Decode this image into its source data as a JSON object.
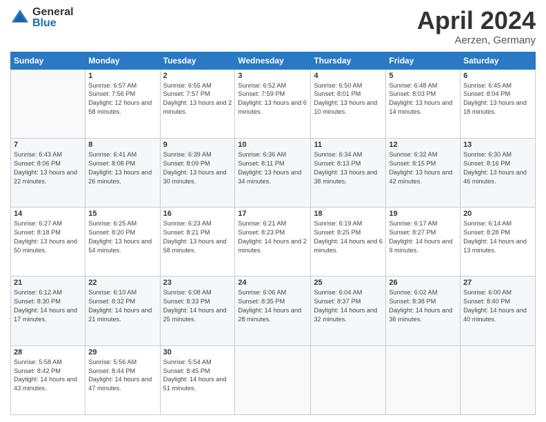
{
  "header": {
    "logo_general": "General",
    "logo_blue": "Blue",
    "month_title": "April 2024",
    "location": "Aerzen, Germany"
  },
  "weekdays": [
    "Sunday",
    "Monday",
    "Tuesday",
    "Wednesday",
    "Thursday",
    "Friday",
    "Saturday"
  ],
  "weeks": [
    [
      {
        "day": "",
        "sunrise": "",
        "sunset": "",
        "daylight": ""
      },
      {
        "day": "1",
        "sunrise": "Sunrise: 6:57 AM",
        "sunset": "Sunset: 7:56 PM",
        "daylight": "Daylight: 12 hours and 58 minutes."
      },
      {
        "day": "2",
        "sunrise": "Sunrise: 6:55 AM",
        "sunset": "Sunset: 7:57 PM",
        "daylight": "Daylight: 13 hours and 2 minutes."
      },
      {
        "day": "3",
        "sunrise": "Sunrise: 6:52 AM",
        "sunset": "Sunset: 7:59 PM",
        "daylight": "Daylight: 13 hours and 6 minutes."
      },
      {
        "day": "4",
        "sunrise": "Sunrise: 6:50 AM",
        "sunset": "Sunset: 8:01 PM",
        "daylight": "Daylight: 13 hours and 10 minutes."
      },
      {
        "day": "5",
        "sunrise": "Sunrise: 6:48 AM",
        "sunset": "Sunset: 8:03 PM",
        "daylight": "Daylight: 13 hours and 14 minutes."
      },
      {
        "day": "6",
        "sunrise": "Sunrise: 6:45 AM",
        "sunset": "Sunset: 8:04 PM",
        "daylight": "Daylight: 13 hours and 18 minutes."
      }
    ],
    [
      {
        "day": "7",
        "sunrise": "Sunrise: 6:43 AM",
        "sunset": "Sunset: 8:06 PM",
        "daylight": "Daylight: 13 hours and 22 minutes."
      },
      {
        "day": "8",
        "sunrise": "Sunrise: 6:41 AM",
        "sunset": "Sunset: 8:08 PM",
        "daylight": "Daylight: 13 hours and 26 minutes."
      },
      {
        "day": "9",
        "sunrise": "Sunrise: 6:39 AM",
        "sunset": "Sunset: 8:09 PM",
        "daylight": "Daylight: 13 hours and 30 minutes."
      },
      {
        "day": "10",
        "sunrise": "Sunrise: 6:36 AM",
        "sunset": "Sunset: 8:11 PM",
        "daylight": "Daylight: 13 hours and 34 minutes."
      },
      {
        "day": "11",
        "sunrise": "Sunrise: 6:34 AM",
        "sunset": "Sunset: 8:13 PM",
        "daylight": "Daylight: 13 hours and 38 minutes."
      },
      {
        "day": "12",
        "sunrise": "Sunrise: 6:32 AM",
        "sunset": "Sunset: 8:15 PM",
        "daylight": "Daylight: 13 hours and 42 minutes."
      },
      {
        "day": "13",
        "sunrise": "Sunrise: 6:30 AM",
        "sunset": "Sunset: 8:16 PM",
        "daylight": "Daylight: 13 hours and 46 minutes."
      }
    ],
    [
      {
        "day": "14",
        "sunrise": "Sunrise: 6:27 AM",
        "sunset": "Sunset: 8:18 PM",
        "daylight": "Daylight: 13 hours and 50 minutes."
      },
      {
        "day": "15",
        "sunrise": "Sunrise: 6:25 AM",
        "sunset": "Sunset: 8:20 PM",
        "daylight": "Daylight: 13 hours and 54 minutes."
      },
      {
        "day": "16",
        "sunrise": "Sunrise: 6:23 AM",
        "sunset": "Sunset: 8:21 PM",
        "daylight": "Daylight: 13 hours and 58 minutes."
      },
      {
        "day": "17",
        "sunrise": "Sunrise: 6:21 AM",
        "sunset": "Sunset: 8:23 PM",
        "daylight": "Daylight: 14 hours and 2 minutes."
      },
      {
        "day": "18",
        "sunrise": "Sunrise: 6:19 AM",
        "sunset": "Sunset: 8:25 PM",
        "daylight": "Daylight: 14 hours and 6 minutes."
      },
      {
        "day": "19",
        "sunrise": "Sunrise: 6:17 AM",
        "sunset": "Sunset: 8:27 PM",
        "daylight": "Daylight: 14 hours and 9 minutes."
      },
      {
        "day": "20",
        "sunrise": "Sunrise: 6:14 AM",
        "sunset": "Sunset: 8:28 PM",
        "daylight": "Daylight: 14 hours and 13 minutes."
      }
    ],
    [
      {
        "day": "21",
        "sunrise": "Sunrise: 6:12 AM",
        "sunset": "Sunset: 8:30 PM",
        "daylight": "Daylight: 14 hours and 17 minutes."
      },
      {
        "day": "22",
        "sunrise": "Sunrise: 6:10 AM",
        "sunset": "Sunset: 8:32 PM",
        "daylight": "Daylight: 14 hours and 21 minutes."
      },
      {
        "day": "23",
        "sunrise": "Sunrise: 6:08 AM",
        "sunset": "Sunset: 8:33 PM",
        "daylight": "Daylight: 14 hours and 25 minutes."
      },
      {
        "day": "24",
        "sunrise": "Sunrise: 6:06 AM",
        "sunset": "Sunset: 8:35 PM",
        "daylight": "Daylight: 14 hours and 28 minutes."
      },
      {
        "day": "25",
        "sunrise": "Sunrise: 6:04 AM",
        "sunset": "Sunset: 8:37 PM",
        "daylight": "Daylight: 14 hours and 32 minutes."
      },
      {
        "day": "26",
        "sunrise": "Sunrise: 6:02 AM",
        "sunset": "Sunset: 8:38 PM",
        "daylight": "Daylight: 14 hours and 36 minutes."
      },
      {
        "day": "27",
        "sunrise": "Sunrise: 6:00 AM",
        "sunset": "Sunset: 8:40 PM",
        "daylight": "Daylight: 14 hours and 40 minutes."
      }
    ],
    [
      {
        "day": "28",
        "sunrise": "Sunrise: 5:58 AM",
        "sunset": "Sunset: 8:42 PM",
        "daylight": "Daylight: 14 hours and 43 minutes."
      },
      {
        "day": "29",
        "sunrise": "Sunrise: 5:56 AM",
        "sunset": "Sunset: 8:44 PM",
        "daylight": "Daylight: 14 hours and 47 minutes."
      },
      {
        "day": "30",
        "sunrise": "Sunrise: 5:54 AM",
        "sunset": "Sunset: 8:45 PM",
        "daylight": "Daylight: 14 hours and 51 minutes."
      },
      {
        "day": "",
        "sunrise": "",
        "sunset": "",
        "daylight": ""
      },
      {
        "day": "",
        "sunrise": "",
        "sunset": "",
        "daylight": ""
      },
      {
        "day": "",
        "sunrise": "",
        "sunset": "",
        "daylight": ""
      },
      {
        "day": "",
        "sunrise": "",
        "sunset": "",
        "daylight": ""
      }
    ]
  ]
}
